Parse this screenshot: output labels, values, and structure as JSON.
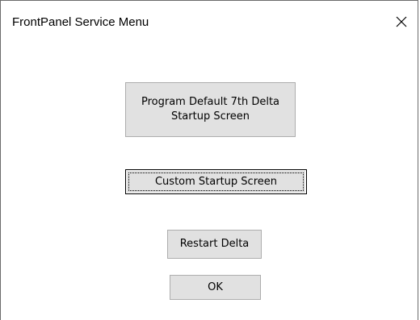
{
  "window": {
    "title": "FrontPanel Service Menu",
    "close_icon": "close-icon"
  },
  "buttons": {
    "program_default": "Program Default 7th Delta\nStartup Screen",
    "custom_startup": "Custom Startup Screen",
    "restart_delta": "Restart Delta",
    "ok": "OK"
  },
  "colors": {
    "button_face": "#e1e1e1",
    "button_border": "#adadad",
    "window_border": "#6b6b6b"
  }
}
